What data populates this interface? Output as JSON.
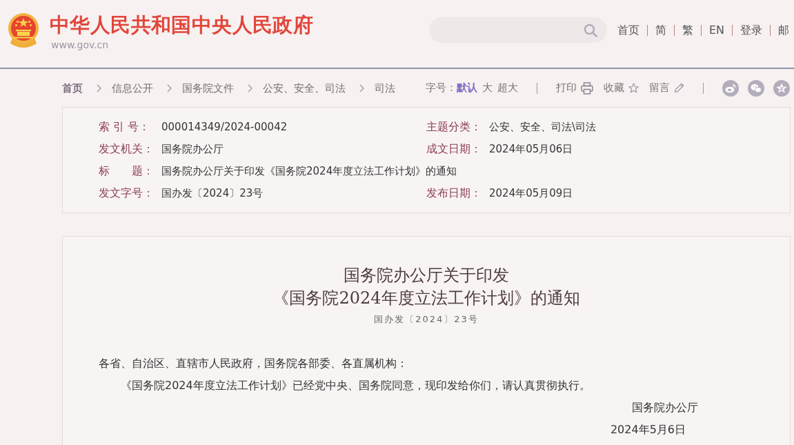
{
  "header": {
    "site_title": "中华人民共和国中央人民政府",
    "site_url": "www.gov.cn",
    "nav_links": [
      "首页",
      "简",
      "繁",
      "EN",
      "登录",
      "邮"
    ]
  },
  "breadcrumb": [
    "首页",
    "信息公开",
    "国务院文件",
    "公安、安全、司法",
    "司法"
  ],
  "toolbar": {
    "font_size_label": "字号：",
    "font_sizes": [
      {
        "label": "默认",
        "selected": true
      },
      {
        "label": "大",
        "selected": false
      },
      {
        "label": "超大",
        "selected": false
      }
    ],
    "actions": [
      {
        "kind": "print",
        "label": "打印"
      },
      {
        "kind": "favorite",
        "label": "收藏"
      },
      {
        "kind": "comment",
        "label": "留言"
      }
    ]
  },
  "document_info": {
    "rows": [
      {
        "cells": [
          {
            "label": "索 引 号：",
            "value": "000014349/2024-00042"
          },
          {
            "label": "主题分类：",
            "value": "公安、安全、司法\\司法"
          }
        ]
      },
      {
        "cells": [
          {
            "label": "发文机关：",
            "value": "国务院办公厅"
          },
          {
            "label": "成文日期：",
            "value": "2024年05月06日"
          }
        ]
      },
      {
        "cells": [
          {
            "label": "标　　题：",
            "value": "国务院办公厅关于印发《国务院2024年度立法工作计划》的通知"
          }
        ]
      },
      {
        "cells": [
          {
            "label": "发文字号：",
            "value": "国办发〔2024〕23号"
          },
          {
            "label": "发布日期：",
            "value": "2024年05月09日"
          }
        ]
      }
    ]
  },
  "article": {
    "title_lines": [
      "国务院办公厅关于印发",
      "《国务院2024年度立法工作计划》的通知"
    ],
    "document_number": "国办发〔2024〕23号",
    "salutation": "各省、自治区、直辖市人民政府，国务院各部委、各直属机构：",
    "paragraphs": [
      "《国务院2024年度立法工作计划》已经党中央、国务院同意，现印发给你们，请认真贯彻执行。"
    ],
    "signature": "国务院办公厅",
    "date": "2024年5月6日"
  }
}
